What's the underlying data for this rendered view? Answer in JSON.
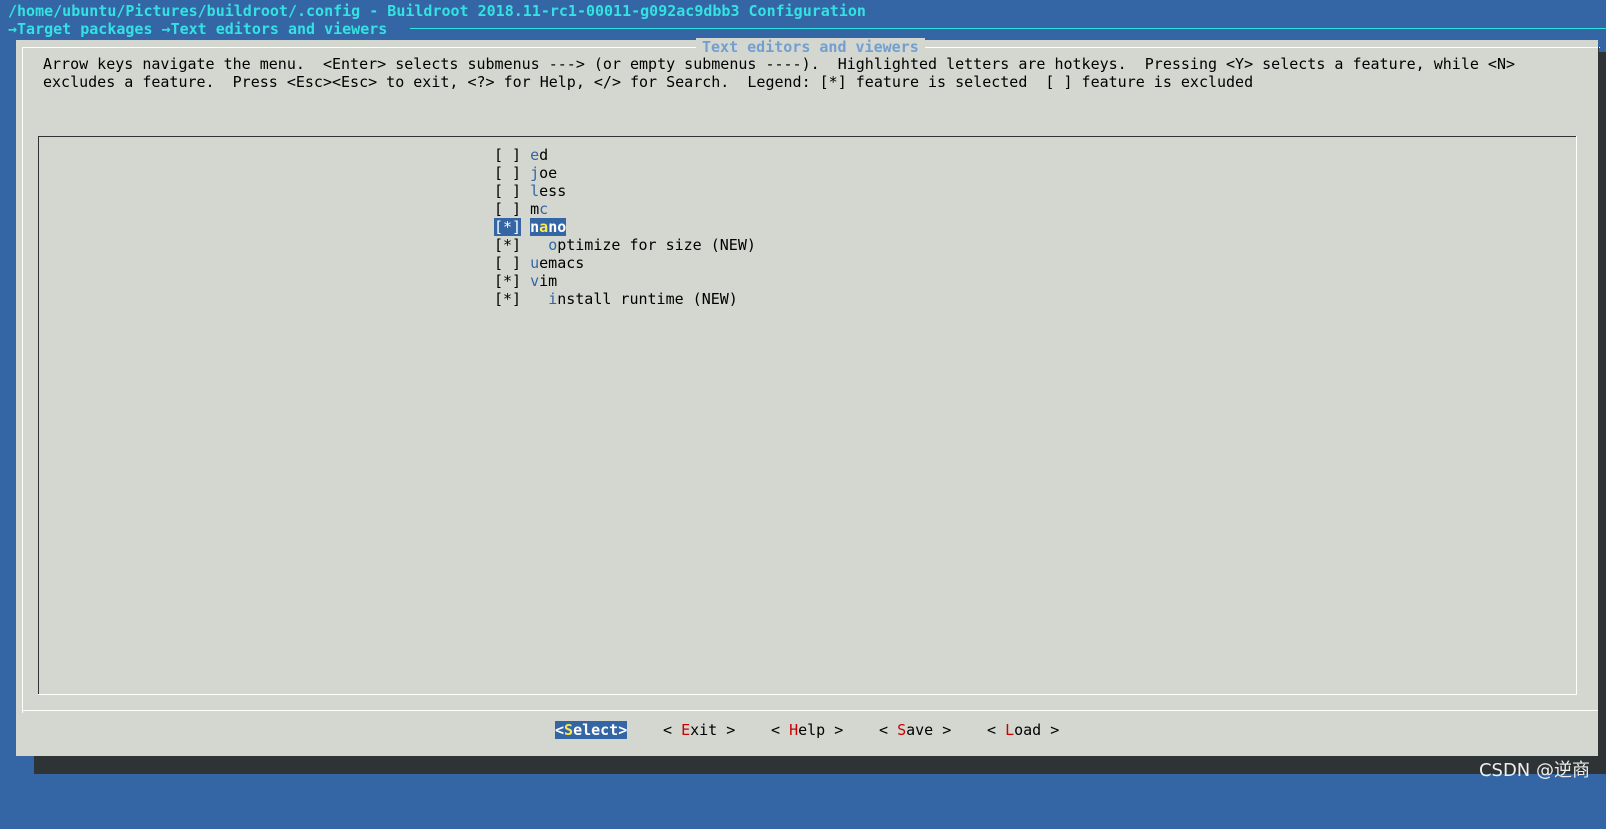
{
  "window": {
    "title": "/home/ubuntu/Pictures/buildroot/.config - Buildroot 2018.11-rc1-00011-g092ac9dbb3 Configuration",
    "breadcrumb": [
      "Target packages",
      "Text editors and viewers"
    ],
    "breadcrumb_separator": "→"
  },
  "dialog": {
    "title": "Text editors and viewers",
    "help_line_1": "Arrow keys navigate the menu.  <Enter> selects submenus ---> (or empty submenus ----).  Highlighted letters are hotkeys.  Pressing <Y> selects a feature, while <N>",
    "help_line_2": "excludes a feature.  Press <Esc><Esc> to exit, <?> for Help, </> for Search.  Legend: [*] feature is selected  [ ] feature is excluded"
  },
  "menu": {
    "items": [
      {
        "box": "[ ]",
        "indent": " ",
        "hotkey": "e",
        "rest": "d",
        "pre": "",
        "selected": false
      },
      {
        "box": "[ ]",
        "indent": " ",
        "hotkey": "j",
        "rest": "oe",
        "pre": "",
        "selected": false
      },
      {
        "box": "[ ]",
        "indent": " ",
        "hotkey": "l",
        "rest": "ess",
        "pre": "",
        "selected": false
      },
      {
        "box": "[ ]",
        "indent": " ",
        "pre": "m",
        "hotkey": "c",
        "rest": "",
        "selected": false
      },
      {
        "box": "[*]",
        "indent": " ",
        "pre": "n",
        "hotkey": "a",
        "rest": "no",
        "selected": true
      },
      {
        "box": "[*]",
        "indent": "   ",
        "hotkey": "o",
        "rest": "ptimize for size (NEW)",
        "pre": "",
        "selected": false
      },
      {
        "box": "[ ]",
        "indent": " ",
        "hotkey": "u",
        "rest": "emacs",
        "pre": "",
        "selected": false
      },
      {
        "box": "[*]",
        "indent": " ",
        "hotkey": "v",
        "rest": "im",
        "pre": "",
        "selected": false
      },
      {
        "box": "[*]",
        "indent": "   ",
        "hotkey": "i",
        "rest": "nstall runtime (NEW)",
        "pre": "",
        "selected": false
      }
    ]
  },
  "buttons": {
    "select": {
      "open": "<",
      "hotkey": "S",
      "rest": "elect",
      "close": ">"
    },
    "exit": {
      "open": "< ",
      "hotkey": "E",
      "rest": "xit",
      "close": " >"
    },
    "help": {
      "open": "< ",
      "hotkey": "H",
      "rest": "elp",
      "close": " >"
    },
    "save": {
      "open": "< ",
      "hotkey": "S",
      "rest": "ave",
      "close": " >"
    },
    "load": {
      "open": "< ",
      "hotkey": "L",
      "rest": "oad",
      "close": " >"
    }
  },
  "watermark": "CSDN @逆商",
  "colors": {
    "background": "#3465a4",
    "dialog": "#d3d7cf",
    "title_cyan": "#34e2e2",
    "hotkey_blue": "#3465a4",
    "button_hotkey_red": "#cc0000",
    "selection": "#3465a4",
    "selection_hotkey": "#fce94f"
  }
}
